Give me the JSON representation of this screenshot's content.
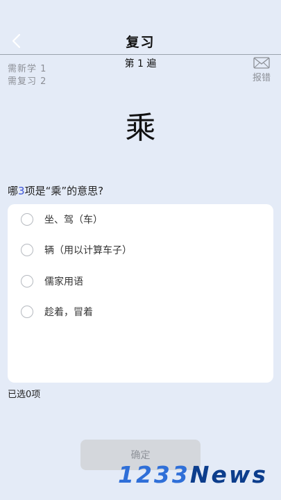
{
  "header": {
    "title": "复习",
    "back_icon": "chevron-left-icon"
  },
  "progress": {
    "pass_label": "第 1 遍",
    "new_to_learn": "需新学 1",
    "to_review": "需复习 2"
  },
  "report": {
    "icon": "envelope-icon",
    "label": "报错"
  },
  "card": {
    "character": "乘"
  },
  "question": {
    "prefix": "哪",
    "count": "3",
    "suffix": "项是“乘”的意思?"
  },
  "options": [
    {
      "label": "坐、驾（车）"
    },
    {
      "label": "辆（用以计算车子）"
    },
    {
      "label": "儒家用语"
    },
    {
      "label": "趁着，冒着"
    }
  ],
  "selection": {
    "selected_text": "已选0项"
  },
  "confirm": {
    "label": "确定"
  },
  "watermark": {
    "digits": "1233",
    "word": "News"
  },
  "colors": {
    "background": "#e4ebf7",
    "accent_number": "#3b52d6",
    "button_disabled": "#d4d7dc",
    "watermark_digits": "#2f6fd8",
    "watermark_word": "#0c3d8c"
  }
}
